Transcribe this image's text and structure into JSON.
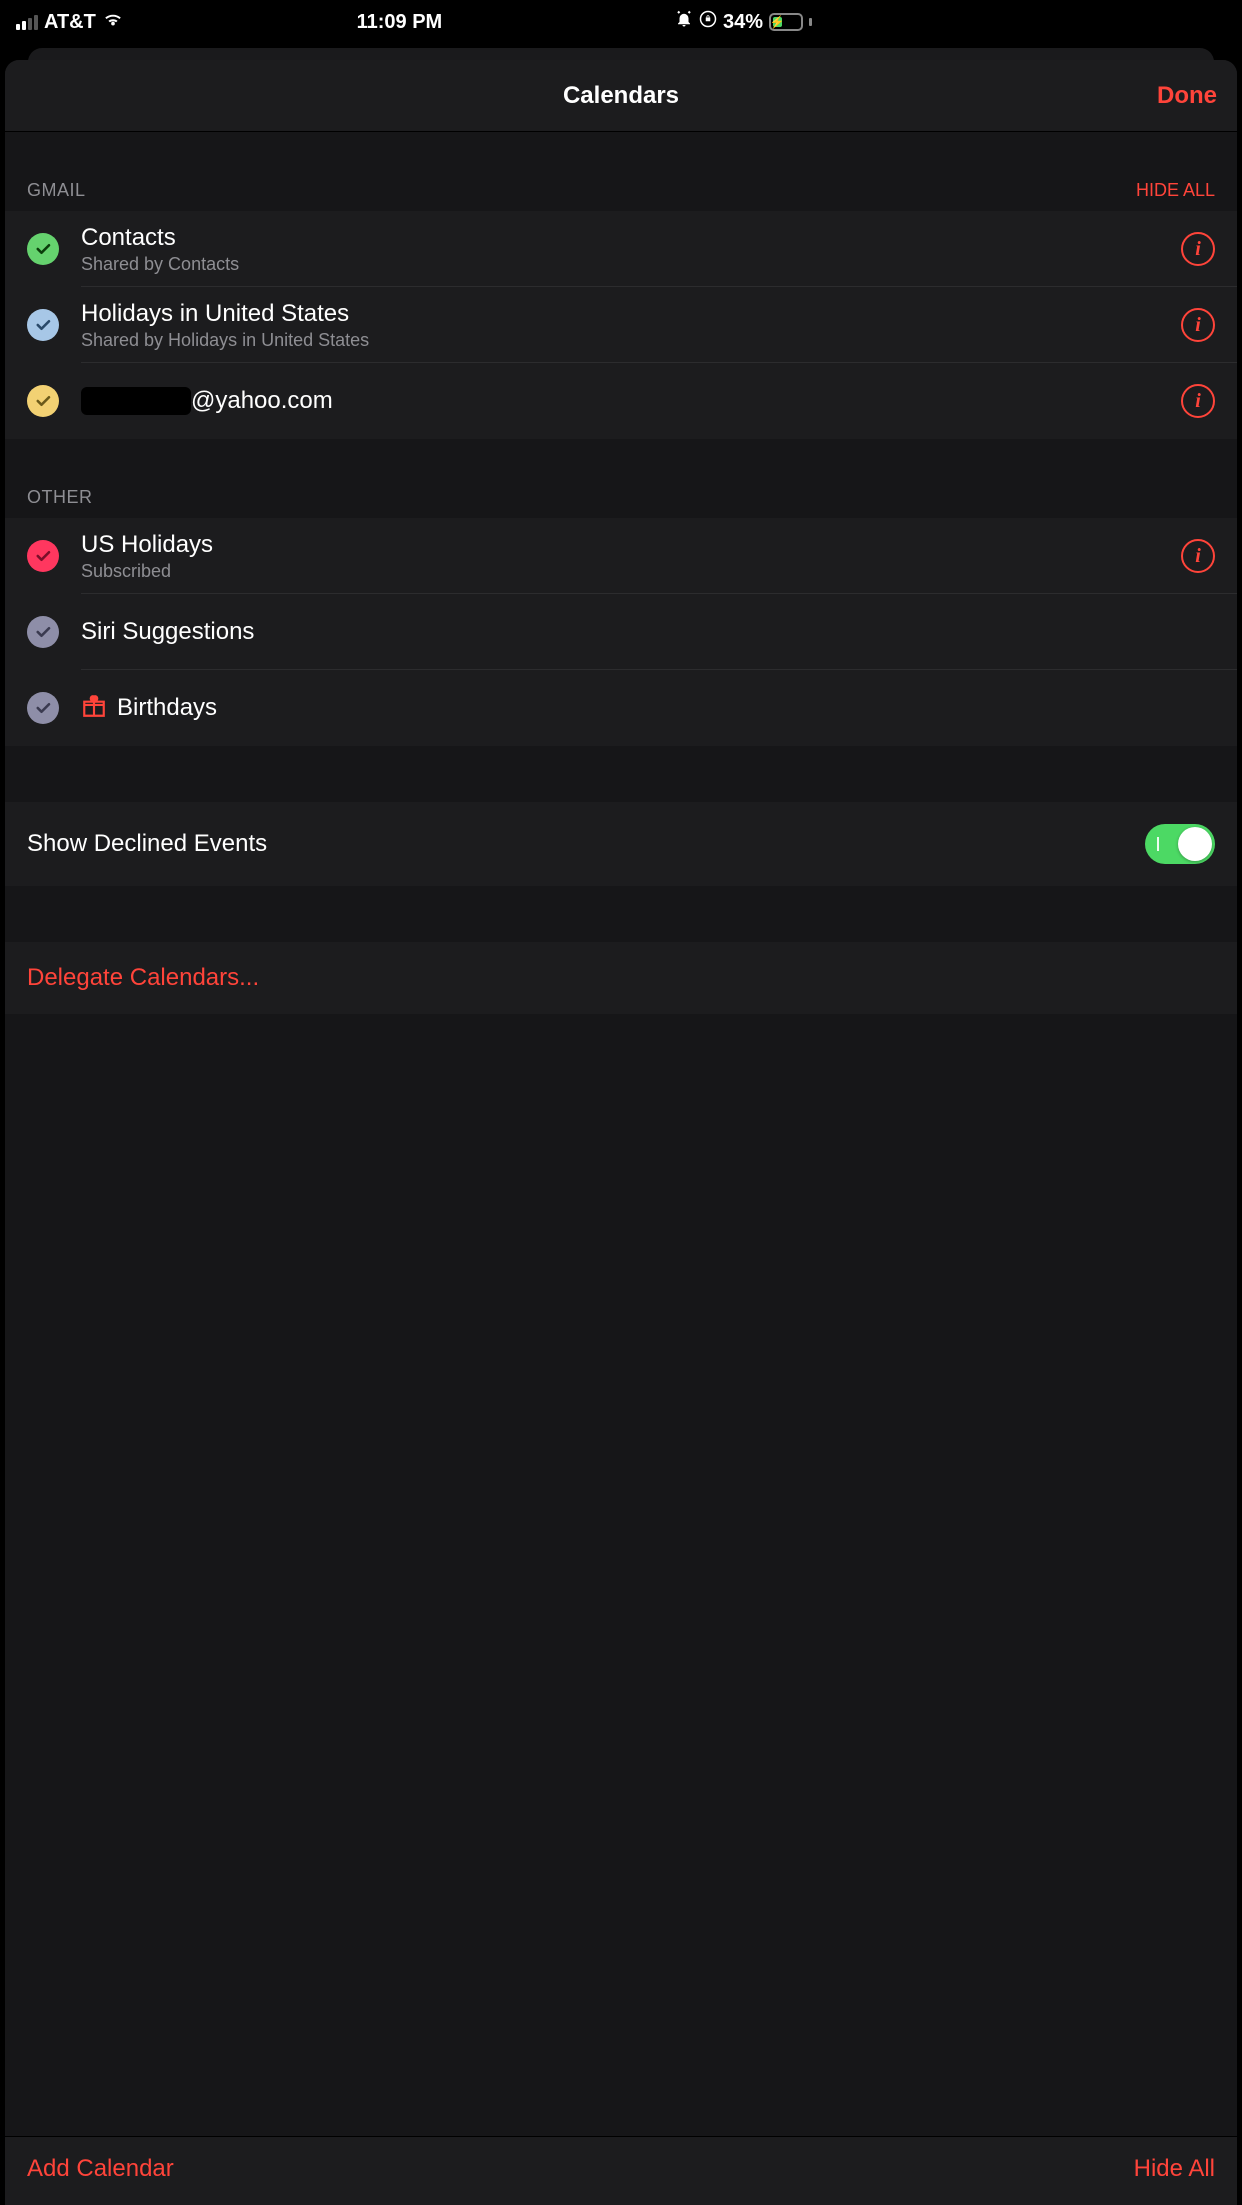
{
  "status": {
    "carrier": "AT&T",
    "time": "11:09 PM",
    "battery_pct": "34%"
  },
  "header": {
    "title": "Calendars",
    "done": "Done"
  },
  "sections": {
    "gmail": {
      "label": "GMAIL",
      "hide_all": "HIDE ALL",
      "items": [
        {
          "title": "Contacts",
          "sub": "Shared by Contacts",
          "color": "#65d26e",
          "check_stroke": "#0a3d0a",
          "has_info": true
        },
        {
          "title": "Holidays in United States",
          "sub": "Shared by Holidays in United States",
          "color": "#a7c7e7",
          "check_stroke": "#2a4a6a",
          "has_info": true
        },
        {
          "title": "@yahoo.com",
          "sub": "",
          "color": "#f2d173",
          "check_stroke": "#6b5a1a",
          "has_info": true,
          "redacted_prefix": true
        }
      ]
    },
    "other": {
      "label": "OTHER",
      "items": [
        {
          "title": "US Holidays",
          "sub": "Subscribed",
          "color": "#ff375f",
          "check_stroke": "#7a0f29",
          "has_info": true
        },
        {
          "title": "Siri Suggestions",
          "sub": "",
          "color": "#8e8ea8",
          "check_stroke": "#3a3a50",
          "has_info": false
        },
        {
          "title": "Birthdays",
          "sub": "",
          "color": "#8e8ea8",
          "check_stroke": "#3a3a50",
          "has_info": false,
          "gift_icon": true
        }
      ]
    }
  },
  "settings": {
    "show_declined": "Show Declined Events",
    "show_declined_on": true,
    "delegate": "Delegate Calendars..."
  },
  "toolbar": {
    "add": "Add Calendar",
    "hide_all": "Hide All"
  }
}
